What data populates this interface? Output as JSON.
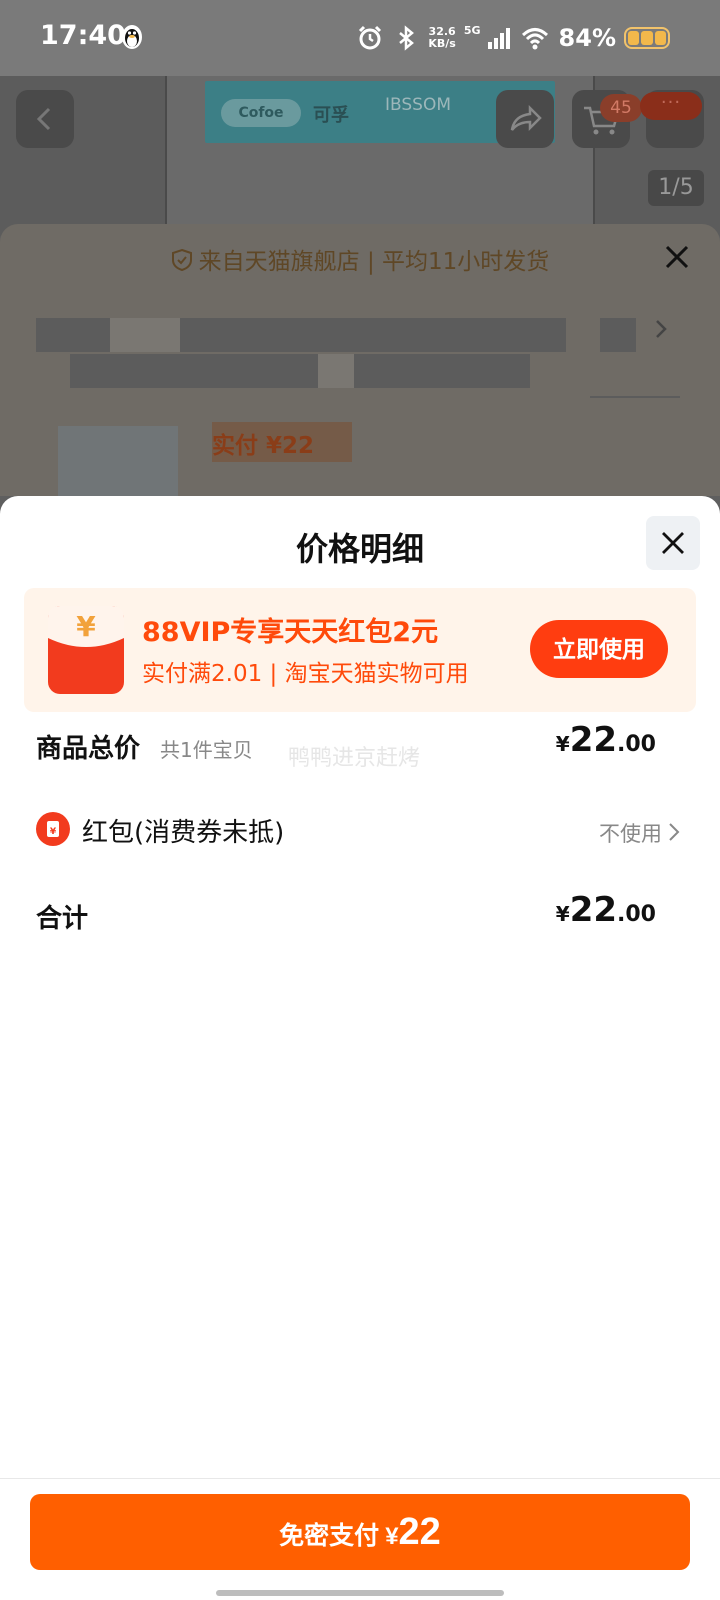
{
  "status_bar": {
    "time": "17:40",
    "net_speed_value": "32.6",
    "net_speed_unit": "KB/s",
    "network_type": "5G",
    "battery_percent": "84%"
  },
  "background_page": {
    "brand_logo": "Cofoe",
    "brand_cn": "可孚",
    "brand_en": "IBSSOM",
    "cart_count": "45",
    "more_badge": "···",
    "image_index": "1/5",
    "store_info": "来自天猫旗舰店 | 平均11小时发货",
    "price_label": "实付 ¥22"
  },
  "sheet": {
    "title": "价格明细",
    "promo": {
      "title": "88VIP专享天天红包2元",
      "subtitle": "实付满2.01 | 淘宝天猫实物可用",
      "button_label": "立即使用"
    },
    "goods_total": {
      "label": "商品总价",
      "sub": "共1件宝贝",
      "currency": "¥",
      "amount_int": "22",
      "amount_dec": ".00"
    },
    "watermark": "鸭鸭进京赶烤",
    "red_packet": {
      "label": "红包(消费券未抵)",
      "value": "不使用"
    },
    "total": {
      "label": "合计",
      "currency": "¥",
      "amount_int": "22",
      "amount_dec": ".00"
    }
  },
  "pay_button": {
    "label": "免密支付",
    "currency": "¥",
    "amount": "22"
  },
  "colors": {
    "accent": "#ff5f00",
    "promo_red": "#ff3d10",
    "promo_bg": "#fff4ea"
  }
}
